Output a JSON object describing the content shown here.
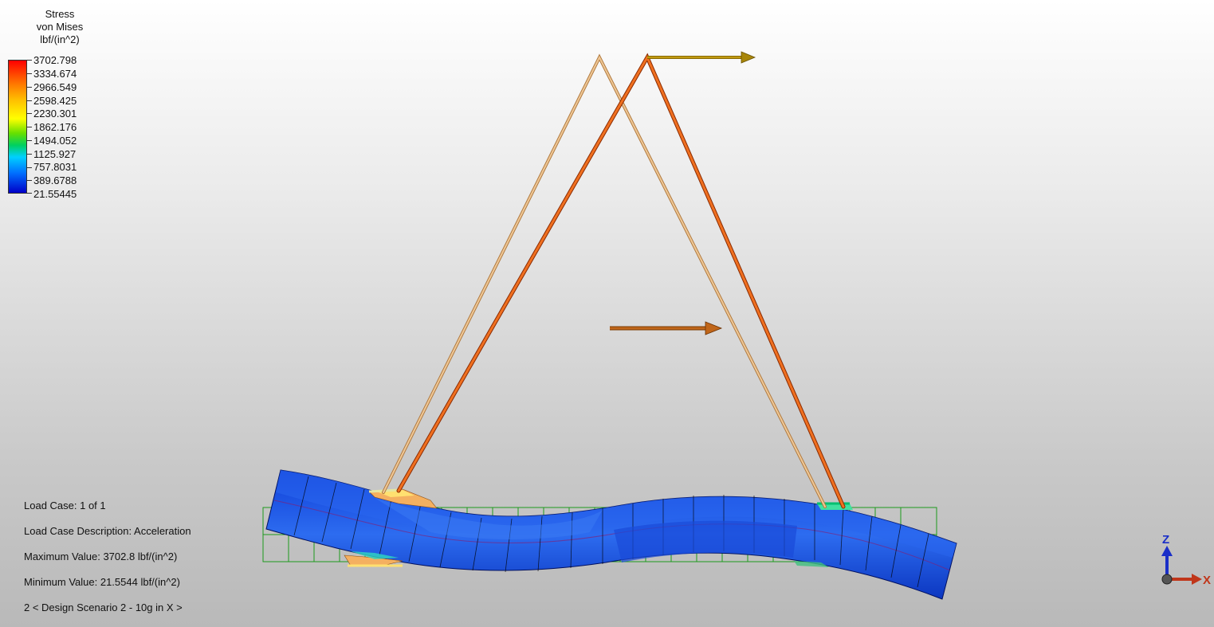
{
  "legend": {
    "title_line1": "Stress",
    "title_line2": "von Mises",
    "title_line3": "lbf/(in^2)",
    "values": [
      "3702.798",
      "3334.674",
      "2966.549",
      "2598.425",
      "2230.301",
      "1862.176",
      "1494.052",
      "1125.927",
      "757.8031",
      "389.6788",
      "21.55445"
    ]
  },
  "info": {
    "load_case": "Load Case:  1 of 1",
    "load_case_description": "Load Case Description:  Acceleration",
    "maximum_value": "Maximum Value: 3702.8 lbf/(in^2)",
    "minimum_value": "Minimum Value: 21.5544 lbf/(in^2)",
    "design_scenario": "2 < Design Scenario 2 - 10g in X >"
  },
  "triad": {
    "z_label": "Z",
    "x_label": "X"
  },
  "colors": {
    "truss_undeformed": "#e6b07a",
    "truss_deformed": "#f06a20",
    "beam_blue": "#1e58e6",
    "mesh_green": "#1d9a1d",
    "load_arrow_top": "#a8860a",
    "load_arrow_mid": "#c0661a",
    "axis_blue": "#1a2fc8",
    "axis_red": "#c0361a"
  }
}
